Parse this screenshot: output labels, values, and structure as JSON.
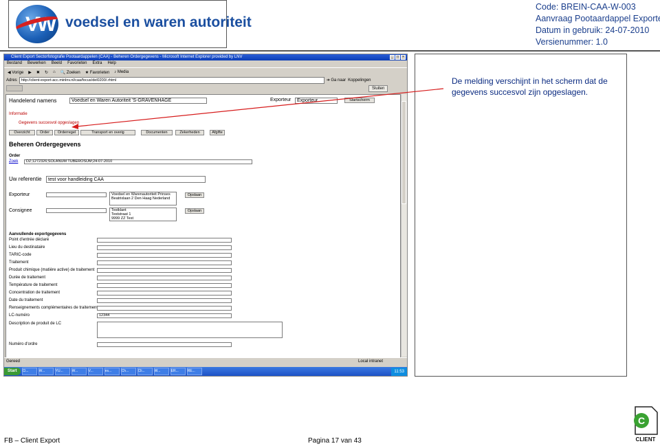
{
  "header": {
    "logo_text": "voedsel en waren autoriteit",
    "code": "Code: BREIN-CAA-W-003",
    "aanvraag": "Aanvraag Pootaardappel Exporteurs",
    "datum": "Datum in gebruik: 24-07-2010",
    "versie": "Versienummer: 1.0"
  },
  "callout": {
    "line1": "De melding verschijnt in het scherm dat de",
    "line2": "gegevens succesvol zijn opgeslagen."
  },
  "browser": {
    "title": "Client Export Sectorfotografie Pootaardappelen (CAA) - Beheren Ordergegevens - Microsoft Internet Explorer provided by LNV",
    "menu": [
      "Bestand",
      "Bewerken",
      "Beeld",
      "Favorieten",
      "Extra",
      "Help"
    ],
    "toolbar": [
      "Vorige",
      "Zoeken",
      "Favorieten",
      "Media"
    ],
    "address_label": "Adres",
    "address": "http://client-export-acc.minlnv.nl/caa/focus/del0200/.rhtml",
    "go_label": "Ga naar",
    "links_label": "Koppelingen",
    "sluiten": "Sluiten",
    "statusbar_left": "Gereed",
    "statusbar_right": "Local intranet",
    "start_label": "Start",
    "tasks": [
      "Cl...",
      "W...",
      "YU...",
      "W...",
      "V...",
      "es...",
      "Ch...",
      "Cli...",
      "W...",
      "ER...",
      "RE..."
    ],
    "clock": "11:53"
  },
  "app": {
    "handelend_label": "Handelend namens",
    "handelend_value": "Voedsel en Waren Autoriteit 'S-GRAVENHAGE",
    "exporteur_label": "Exporteur",
    "exporteur_value": "Exporteur",
    "startscherm": "Startscherm",
    "info_label": "Informatie",
    "info_message": "Gegevens succesvol opgeslagen",
    "tabs": [
      "Overzicht",
      "Order",
      "Orderregel",
      "Transport en overig",
      "Documenten",
      "Zekerheden",
      "Afgifte"
    ],
    "page_title": "Beheren Ordergegevens",
    "order_label": "Order",
    "order_prefix": "Zoek",
    "order_value": "DZ;1272326;SOLANUM TUBEROSUM;24-07-2010",
    "ref_label": "Uw referentie",
    "ref_value": "test voor handleiding CAA",
    "exporteur_row_label": "Exporteur",
    "exporteur_addr_1": "Voedsel en Warenautoriteit Prinses",
    "exporteur_addr_2": "Beatrixlaan 2 Den Haag Nederland",
    "opslaan": "Opslaan",
    "consignee_label": "Consignee",
    "consignee_addr_1": "Testklant",
    "consignee_addr_2": "Teststraat 1",
    "consignee_addr_3": "9999 ZZ Test",
    "section_title": "Aanvullende exportgegevens",
    "fields": [
      {
        "label": "Point d'entrée déclaré",
        "value": ""
      },
      {
        "label": "Lieu du destinataire",
        "value": ""
      },
      {
        "label": "TARIC-code",
        "value": ""
      },
      {
        "label": "Traitement",
        "value": ""
      },
      {
        "label": "Produit chimique (matière active) de traitement",
        "value": ""
      },
      {
        "label": "Durée de traitement",
        "value": ""
      },
      {
        "label": "Température de traitement",
        "value": ""
      },
      {
        "label": "Concentration de traitement",
        "value": ""
      },
      {
        "label": "Date du traitement",
        "value": ""
      },
      {
        "label": "Renseignements complémentaires de traitement",
        "value": ""
      },
      {
        "label": "LC-numéro",
        "value": "12344"
      }
    ],
    "desc_label": "Description de produit de LC",
    "numero_label": "Numéro d'ordre"
  },
  "footer": {
    "left": "FB – Client Export",
    "center": "Pagina 17 van 43",
    "client_logo": "CLIENT"
  }
}
